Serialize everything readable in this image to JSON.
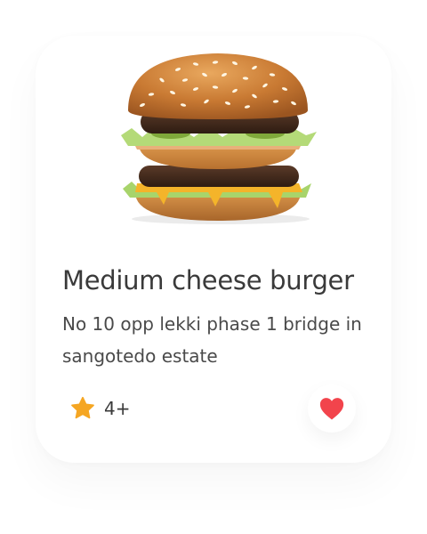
{
  "product": {
    "title": "Medium cheese burger",
    "description": "No 10 opp lekki phase 1 bridge in sangotedo estate",
    "rating": "4+",
    "image_icon": "burger-image",
    "rating_icon": "star-icon",
    "favorite_icon": "heart-icon"
  },
  "colors": {
    "star": "#F5A623",
    "heart": "#F2444C",
    "title_text": "#3A3A3A",
    "body_text": "#4A4A4A"
  }
}
